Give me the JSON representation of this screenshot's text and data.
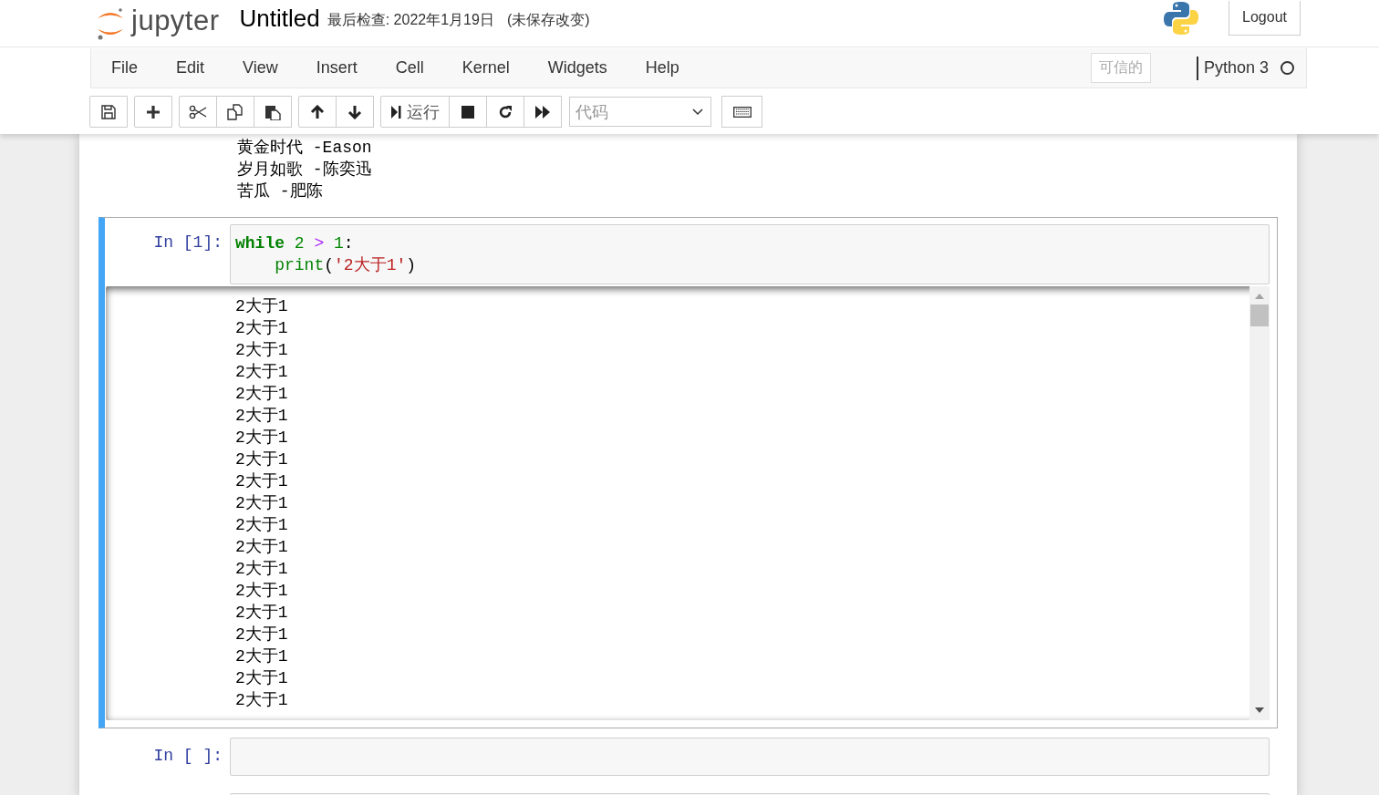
{
  "header": {
    "logo_text": "jupyter",
    "title": "Untitled",
    "checkpoint": "最后检查: 2022年1月19日",
    "autosave": "(未保存改变)",
    "logout": "Logout"
  },
  "menu": [
    "File",
    "Edit",
    "View",
    "Insert",
    "Cell",
    "Kernel",
    "Widgets",
    "Help"
  ],
  "trusted": "可信的",
  "kernel": {
    "name": "Python 3",
    "busy": false
  },
  "toolbar": {
    "groups": [
      [
        {
          "kind": "save"
        }
      ],
      [
        {
          "kind": "plus"
        }
      ],
      [
        {
          "kind": "cut"
        },
        {
          "kind": "copy"
        },
        {
          "kind": "paste"
        }
      ],
      [
        {
          "kind": "up"
        },
        {
          "kind": "down"
        }
      ],
      [
        {
          "kind": "run",
          "label": "运行"
        },
        {
          "kind": "stop"
        },
        {
          "kind": "restart"
        },
        {
          "kind": "fastforward"
        }
      ]
    ],
    "cell_type": "代码"
  },
  "previous_output": [
    "黄金时代 -Eason",
    "岁月如歌 -陈奕迅",
    "苦瓜 -肥陈"
  ],
  "cells": [
    {
      "prompt": "In [1]:",
      "selected": true,
      "code": [
        {
          "tokens": [
            {
              "kind": "keyword",
              "text": "while"
            },
            {
              "kind": "number",
              "text": " 2"
            },
            {
              "kind": "operator",
              "text": " >"
            },
            {
              "kind": "number",
              "text": " 1"
            },
            {
              "kind": "punct",
              "text": ":"
            }
          ]
        },
        {
          "tokens": [
            {
              "kind": "builtin",
              "text": "    print"
            },
            {
              "kind": "punct",
              "text": "("
            },
            {
              "kind": "string",
              "text": "'2大于1'"
            },
            {
              "kind": "punct",
              "text": ")"
            }
          ]
        }
      ],
      "output_scrolled": true,
      "output": [
        "2大于1",
        "2大于1",
        "2大于1",
        "2大于1",
        "2大于1",
        "2大于1",
        "2大于1",
        "2大于1",
        "2大于1",
        "2大于1",
        "2大于1",
        "2大于1",
        "2大于1",
        "2大于1",
        "2大于1",
        "2大于1",
        "2大于1",
        "2大于1",
        "2大于1"
      ]
    },
    {
      "prompt": "In [ ]:",
      "selected": false
    },
    {
      "selected": false
    }
  ]
}
